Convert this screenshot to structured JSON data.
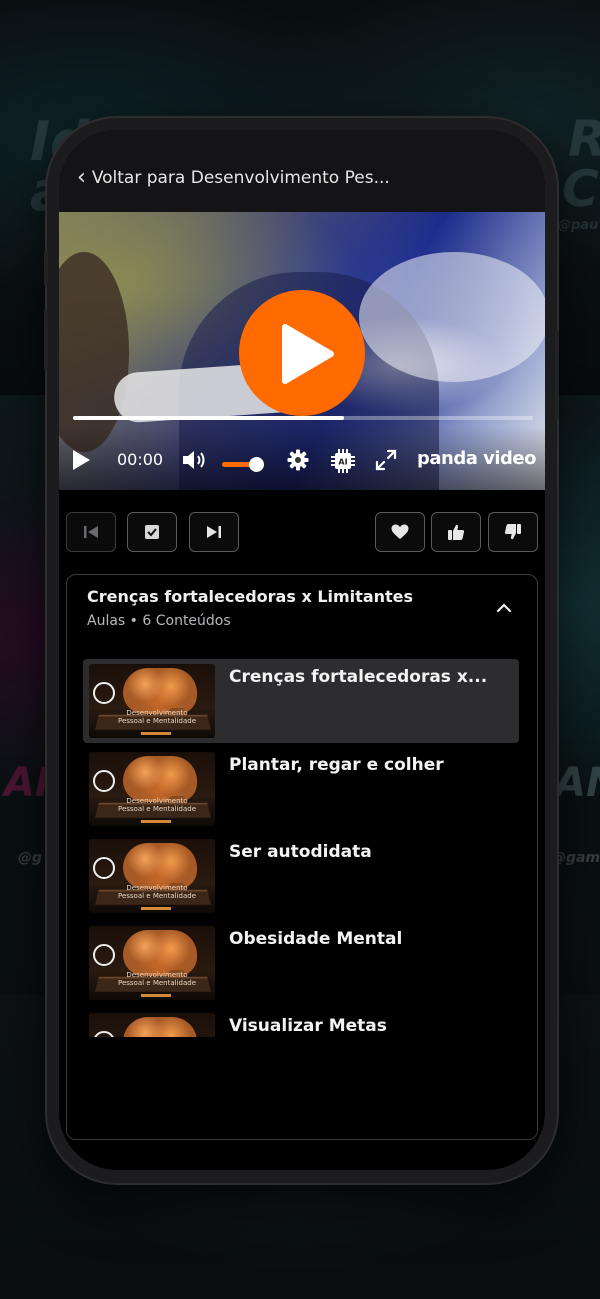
{
  "background": {
    "fragments": [
      "Ide",
      "au",
      "R",
      "Cr",
      "@pau",
      "@g",
      "@gam",
      "AM",
      "AN"
    ]
  },
  "header": {
    "back_label": "Voltar para Desenvolvimento Pes..."
  },
  "player": {
    "time": "00:00",
    "progress": 0.59,
    "volume": 0.82,
    "brand": "panda video",
    "accent": "#ff6b00",
    "icons": [
      "play-icon",
      "volume-icon",
      "settings-icon",
      "ai-icon",
      "fullscreen-icon"
    ]
  },
  "actions": {
    "left": [
      "previous-lesson",
      "mark-complete",
      "next-lesson"
    ],
    "right": [
      "favorite",
      "like",
      "dislike"
    ]
  },
  "playlist": {
    "title": "Crenças fortalecedoras x Limitantes",
    "subtitle": "Aulas • 6 Conteúdos",
    "thumbnail_caption": [
      "Desenvolvimento",
      "Pessoal e Mentalidade"
    ],
    "lessons": [
      {
        "title": "Crenças fortalecedoras x...",
        "active": true
      },
      {
        "title": "Plantar, regar e colher",
        "active": false
      },
      {
        "title": "Ser autodidata",
        "active": false
      },
      {
        "title": "Obesidade Mental",
        "active": false
      },
      {
        "title": "Visualizar Metas",
        "active": false
      }
    ]
  }
}
